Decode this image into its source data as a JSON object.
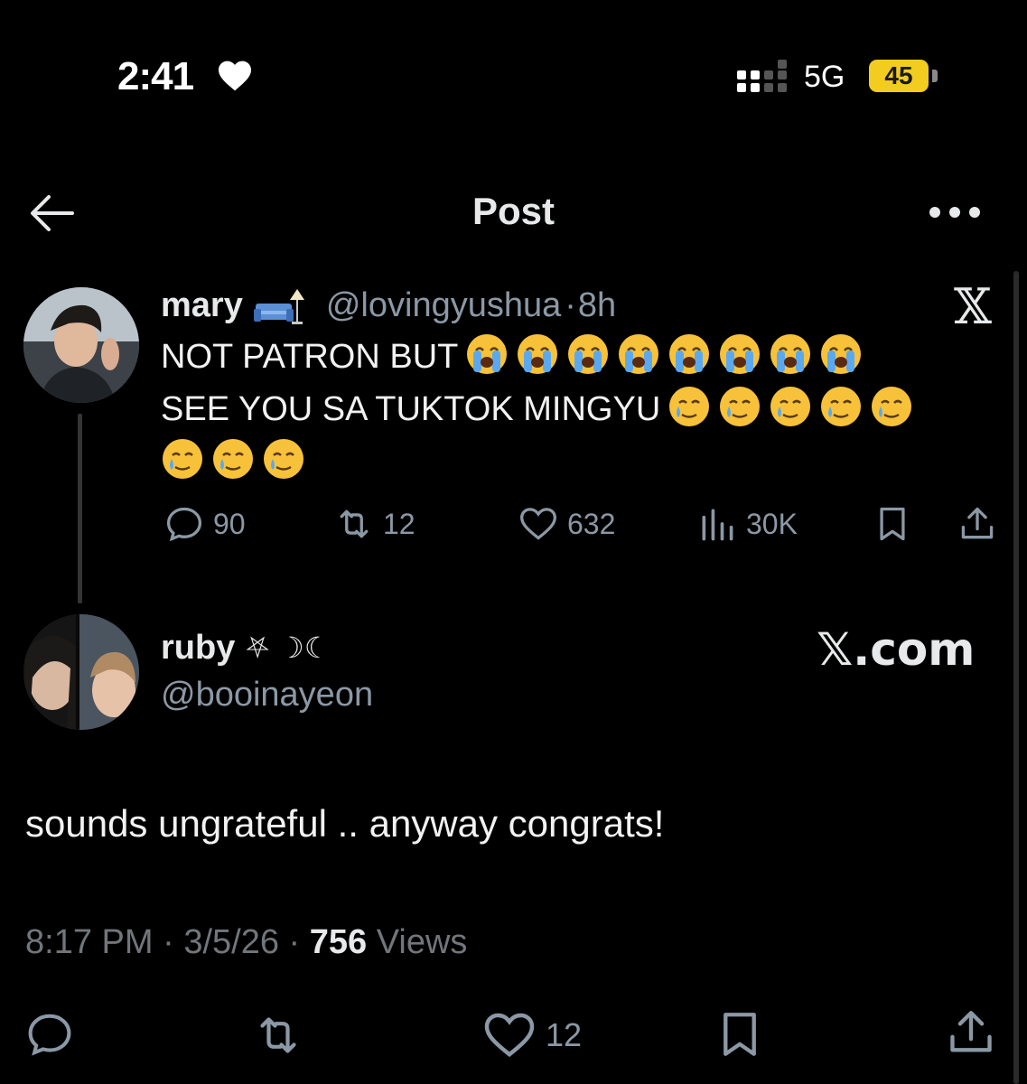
{
  "status_bar": {
    "time": "2:41",
    "network": "5G",
    "battery": "45",
    "battery_color": "#f2cc1f"
  },
  "header": {
    "title": "Post",
    "back_icon": "arrow-left-icon",
    "more_icon": "more-dots-icon"
  },
  "parent_post": {
    "name": "mary",
    "name_emoji": "sofa-lamp-icon",
    "handle": "@lovingyushua",
    "separator": "·",
    "age": "8h",
    "line1": "NOT PATRON BUT",
    "line1_emoji": [
      "crying-emoji",
      "crying-emoji",
      "crying-emoji",
      "crying-emoji",
      "crying-emoji",
      "crying-emoji",
      "crying-emoji",
      "crying-emoji"
    ],
    "line2": "SEE YOU SA TUKTOK MINGYU",
    "line2_emoji": [
      "tear-smile-emoji",
      "tear-smile-emoji",
      "tear-smile-emoji",
      "tear-smile-emoji",
      "tear-smile-emoji"
    ],
    "line3_emoji": [
      "tear-smile-emoji",
      "tear-smile-emoji",
      "tear-smile-emoji"
    ],
    "replies": "90",
    "reposts": "12",
    "likes": "632",
    "views": "30K",
    "x_logo": "𝕏"
  },
  "reply_post": {
    "name": "ruby",
    "name_symbols": "⛧ ☽︎☾",
    "handle": "@booinayeon",
    "watermark": "𝕏.com",
    "text": "sounds ungrateful .. anyway congrats!",
    "time": "8:17 PM",
    "date": "3/5/26",
    "dot": "·",
    "views_count": "756",
    "views_label": "Views",
    "likes": "12"
  },
  "colors": {
    "background": "#000000",
    "text": "#e7e9ea",
    "muted": "#8b98a5"
  }
}
